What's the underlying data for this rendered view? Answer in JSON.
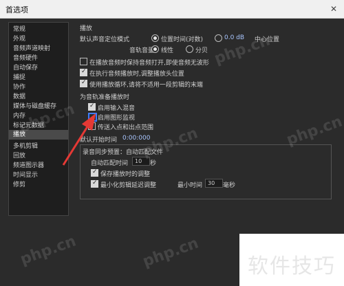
{
  "window": {
    "title": "首选项",
    "close_symbol": "✕"
  },
  "sidebar": {
    "items": [
      {
        "label": "常规"
      },
      {
        "label": "外观"
      },
      {
        "label": "音频声道映射"
      },
      {
        "label": "音频硬件"
      },
      {
        "label": "自动保存"
      },
      {
        "label": "捕捉"
      },
      {
        "label": "协作"
      },
      {
        "label": "数据"
      },
      {
        "label": "媒体与磁盘缓存"
      },
      {
        "label": "内存"
      },
      {
        "label": "标记元数据"
      },
      {
        "label": "播放"
      },
      {
        "label": "多机剪辑"
      },
      {
        "label": "回放"
      },
      {
        "label": "频道图示器"
      },
      {
        "label": "时间显示"
      },
      {
        "label": "修剪"
      }
    ],
    "selected_index": 11
  },
  "panel": {
    "section_title": "播放",
    "default_position_label": "默认声音定位模式",
    "default_position_options": [
      {
        "label": "位置时间(对数)",
        "checked": true
      },
      {
        "label": "中心位置",
        "checked": false
      }
    ],
    "default_position_value": "0.0 dB",
    "secondary_label": "音轨音量",
    "secondary_options": [
      {
        "label": "线性",
        "checked": true
      },
      {
        "label": "分贝",
        "checked": false
      }
    ],
    "checkboxes_top": [
      {
        "label": "在播放音频时保持音频打开,即使音频无波形",
        "checked": false
      },
      {
        "label": "在执行音频播放时,调整播放头位置",
        "checked": true
      },
      {
        "label": "使用播放循环,请将不适用一段剪辑的末端",
        "checked": true
      }
    ],
    "group_title": "为音轨准备播放时",
    "group_items": [
      {
        "label": "启用输入混音",
        "checked": true
      },
      {
        "label": "启用图形监视",
        "checked": false,
        "highlight": true
      },
      {
        "label": "传送入点和出点范围",
        "checked": false
      }
    ],
    "default_time_label": "默认开始时间",
    "default_time_value": "0:00:000",
    "sync_group_title": "录音同步预置：自动匹配文件",
    "sync_seconds_label": "自动匹配时间",
    "sync_seconds_value": "10",
    "sync_seconds_unit": "秒",
    "sync_checkboxes": [
      {
        "label": "保存播放时的调整",
        "checked": true
      },
      {
        "label": "最小化剪辑延迟调整",
        "checked": true
      }
    ],
    "sync_min_label": "最小时间",
    "sync_min_value": "30",
    "sync_min_unit": "毫秒"
  },
  "watermarks": [
    "php.cn",
    "php.cn",
    "php.cn",
    "php.cn",
    "php.cn",
    "php.cn"
  ],
  "corner_badge": "软件技巧"
}
